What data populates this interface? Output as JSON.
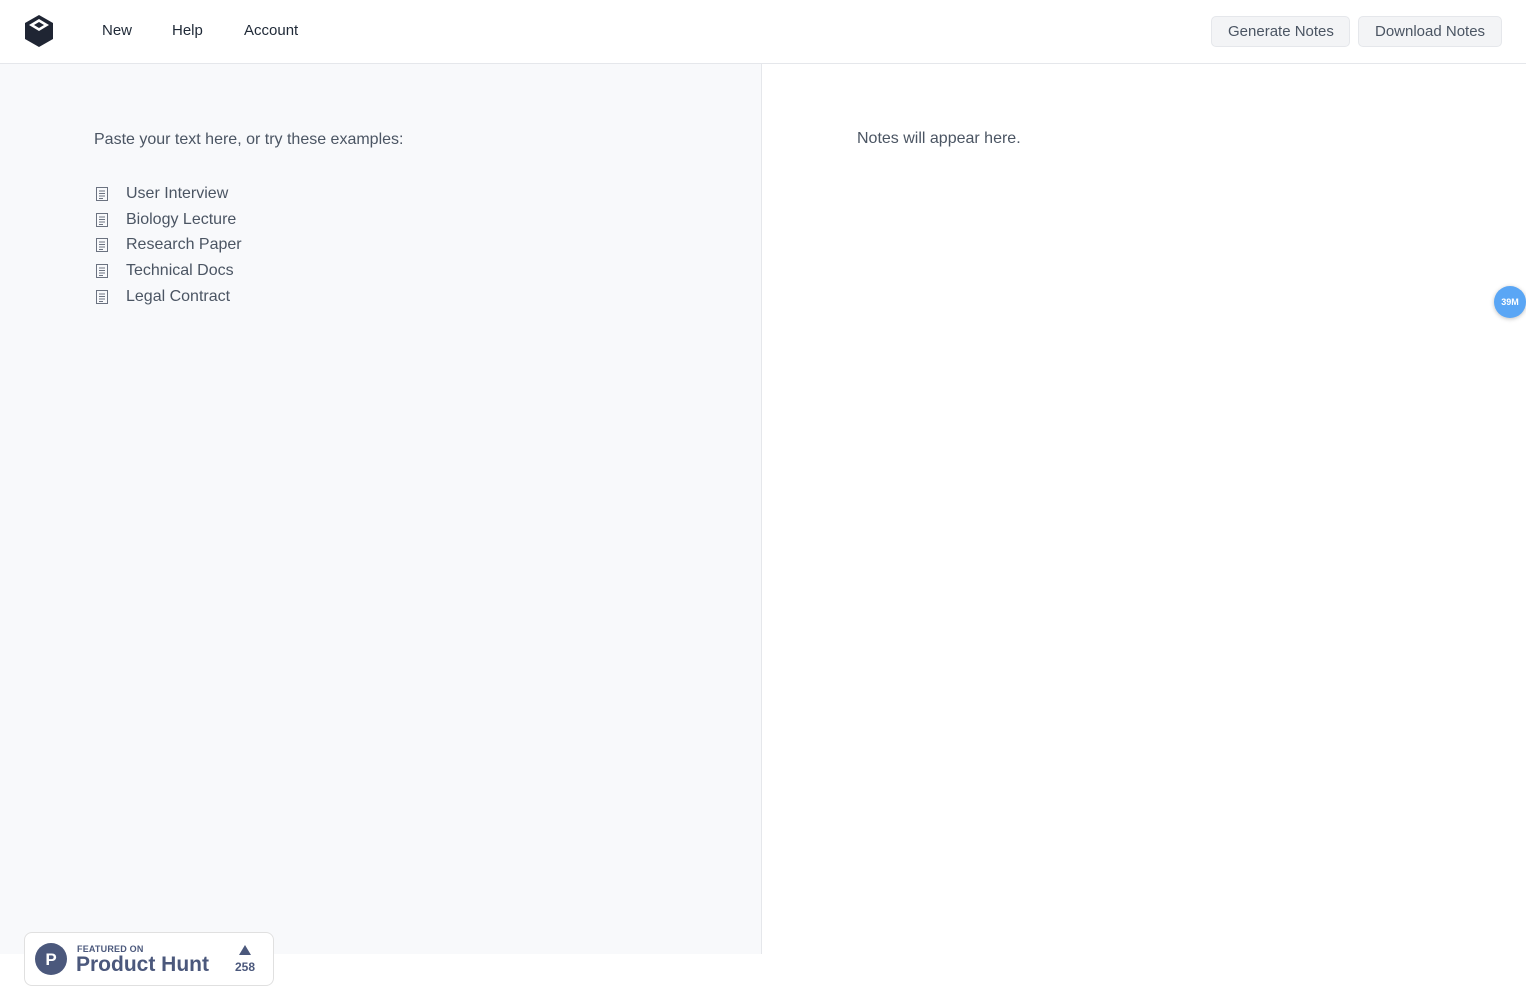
{
  "header": {
    "logo_icon": "box-logo-icon",
    "nav": [
      {
        "label": "New"
      },
      {
        "label": "Help"
      },
      {
        "label": "Account"
      }
    ],
    "buttons": {
      "generate": "Generate Notes",
      "download": "Download Notes"
    }
  },
  "input_pane": {
    "prompt": "Paste your text here, or try these examples:",
    "examples": [
      {
        "label": "User Interview",
        "icon": "document-icon"
      },
      {
        "label": "Biology Lecture",
        "icon": "document-icon"
      },
      {
        "label": "Research Paper",
        "icon": "document-icon"
      },
      {
        "label": "Technical Docs",
        "icon": "document-icon"
      },
      {
        "label": "Legal Contract",
        "icon": "document-icon"
      }
    ]
  },
  "notes_pane": {
    "placeholder": "Notes will appear here."
  },
  "product_hunt": {
    "featured": "FEATURED ON",
    "name": "Product Hunt",
    "votes": "258",
    "logo_letter": "P",
    "color": "#4b587c"
  },
  "floating_badge": {
    "label": "39M",
    "color": "#5aa6f5"
  }
}
